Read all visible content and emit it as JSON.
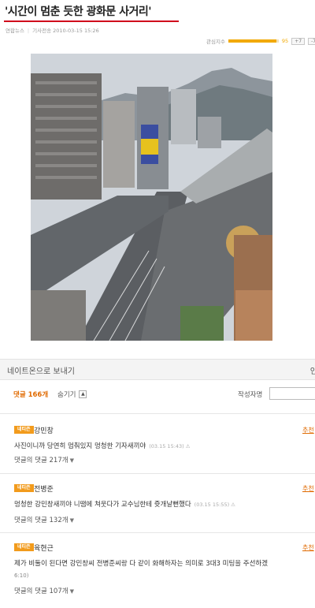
{
  "article": {
    "headline": "'시간이 멈춘 듯한 광화문 사거리'",
    "byline_source": "연합뉴스",
    "byline_label": "기사전송",
    "byline_date": "2010-03-15 15:26"
  },
  "rating": {
    "label": "관심지수",
    "score": "95",
    "fill_fraction": 0.95,
    "plus_label": "+7",
    "minus_label": "-7"
  },
  "nate": {
    "send_label": "네이트온으로 보내기",
    "right_label": "인"
  },
  "toolbar": {
    "reply_count": "댓글 166개",
    "hide_label": "숨기기",
    "hide_icon_glyph": "▲",
    "author_sort_label": "작성자명"
  },
  "comments": [
    {
      "badge": "네티즌",
      "name": "강민창",
      "recommend": "추천",
      "text": "사진이니까 당연히 멈춰있지 멍청한 기자새끼야",
      "time": "(03.15 15:43)",
      "warn": "⚠",
      "continuation": "",
      "replies": "댓글의 댓글 217개",
      "arrow": "▼"
    },
    {
      "badge": "네티즌",
      "name": "전병준",
      "recommend": "추천",
      "text": "멍청한 강민창새끼야 니땜에 쳐웃다가 교수님한테 쥿개날뻔했다",
      "time": "(03.15 15:55)",
      "warn": "⚠",
      "continuation": "",
      "replies": "댓글의 댓글 132개",
      "arrow": "▼"
    },
    {
      "badge": "네티즌",
      "name": "육현근",
      "recommend": "추천",
      "text": "제가 비둘이 된다면 강민창씨 전병준씨랑 다 같이 화해하자는 의미로 3대3 미팅을 주선하겠",
      "time": "",
      "warn": "",
      "continuation": "6:10)",
      "replies": "댓글의 댓글 107개",
      "arrow": "▼"
    }
  ],
  "colors": {
    "accent_red": "#d0021b",
    "accent_orange": "#e06a00",
    "badge": "#f29b1c"
  }
}
